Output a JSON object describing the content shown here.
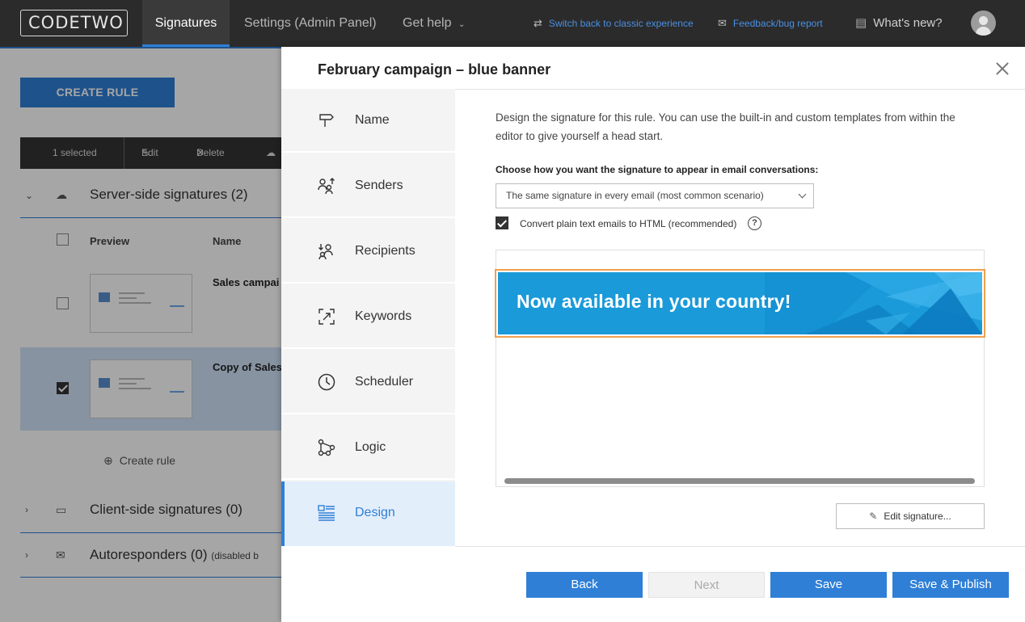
{
  "topbar": {
    "logo": "CODETWO",
    "tabs": [
      "Signatures",
      "Settings (Admin Panel)",
      "Get help"
    ],
    "switch_link": "Switch back to classic experience",
    "feedback_link": "Feedback/bug report",
    "whats_new": "What's new?"
  },
  "bg": {
    "create_rule": "CREATE RULE",
    "toolbar": {
      "selected": "1 selected",
      "edit": "Edit",
      "delete": "Delete"
    },
    "server_section": "Server-side signatures (2)",
    "col_preview": "Preview",
    "col_name": "Name",
    "rows": [
      {
        "name": "Sales campai",
        "checked": false
      },
      {
        "name": "Copy of Sales",
        "checked": true
      }
    ],
    "create_rule_link": "Create rule",
    "client_section": "Client-side signatures (0)",
    "autoresponders": "Autoresponders (0)",
    "autoresponders_note": "(disabled b"
  },
  "modal": {
    "title": "February campaign – blue banner",
    "steps": [
      "Name",
      "Senders",
      "Recipients",
      "Keywords",
      "Scheduler",
      "Logic",
      "Design"
    ],
    "active_step": "Design",
    "intro": "Design the signature for this rule. You can use the built-in and custom templates from within the editor to give yourself a head start.",
    "choose_label": "Choose how you want the signature to appear in email conversations:",
    "select_value": "The same signature in every email (most common scenario)",
    "convert_label": "Convert plain text emails to HTML (recommended)",
    "convert_checked": true,
    "banner_text": "Now available in your country!",
    "edit_signature": "Edit signature...",
    "buttons": {
      "back": "Back",
      "next": "Next",
      "save": "Save",
      "save_publish": "Save & Publish"
    }
  },
  "colors": {
    "accent": "#2f7fd6",
    "banner": "#1a9ad9",
    "highlight": "#f0a050"
  }
}
